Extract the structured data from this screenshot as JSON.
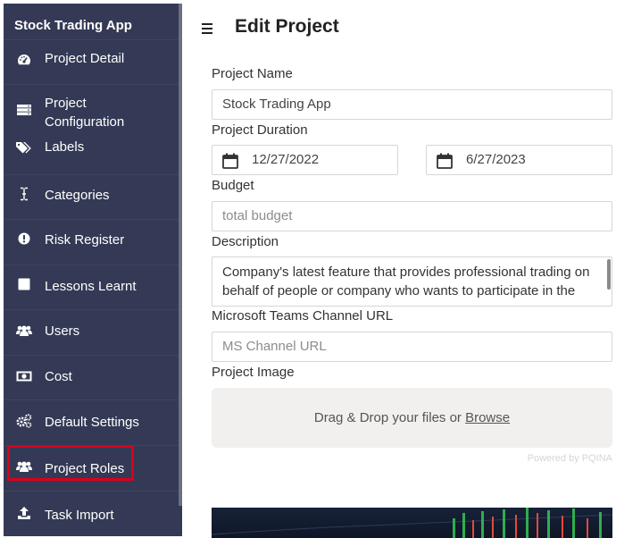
{
  "sidebar": {
    "title": "Stock Trading App",
    "items": [
      {
        "label": "Project Detail",
        "icon": "dashboard-icon"
      },
      {
        "label": "Project Configuration",
        "icon": "server-icon"
      },
      {
        "label": "Labels",
        "icon": "tags-icon"
      },
      {
        "label": "Categories",
        "icon": "text-cursor-icon"
      },
      {
        "label": "Risk Register",
        "icon": "exclamation-icon"
      },
      {
        "label": "Lessons Learnt",
        "icon": "square-icon"
      },
      {
        "label": "Users",
        "icon": "users-icon"
      },
      {
        "label": "Cost",
        "icon": "money-bill-icon"
      },
      {
        "label": "Default Settings",
        "icon": "cogs-icon"
      },
      {
        "label": "Project Roles",
        "icon": "users-icon"
      },
      {
        "label": "Task Import",
        "icon": "upload-icon"
      }
    ],
    "highlighted_item": "Project Roles",
    "highlight_color": "#d9001b",
    "background_color": "#343a55"
  },
  "header": {
    "title": "Edit Project"
  },
  "form": {
    "project_name": {
      "label": "Project Name",
      "value": "Stock Trading App"
    },
    "project_duration": {
      "label": "Project Duration",
      "start": "12/27/2022",
      "end": "6/27/2023"
    },
    "budget": {
      "label": "Budget",
      "placeholder": "total budget"
    },
    "description": {
      "label": "Description",
      "value": "Company's latest feature that provides professional trading on behalf of people or company who wants to participate in the"
    },
    "teams_url": {
      "label": "Microsoft Teams Channel URL",
      "placeholder": "MS Channel URL"
    },
    "project_image": {
      "label": "Project Image",
      "drop_text": "Drag & Drop your files or",
      "browse_text": "Browse",
      "powered_by": "Powered by PQINA"
    }
  }
}
